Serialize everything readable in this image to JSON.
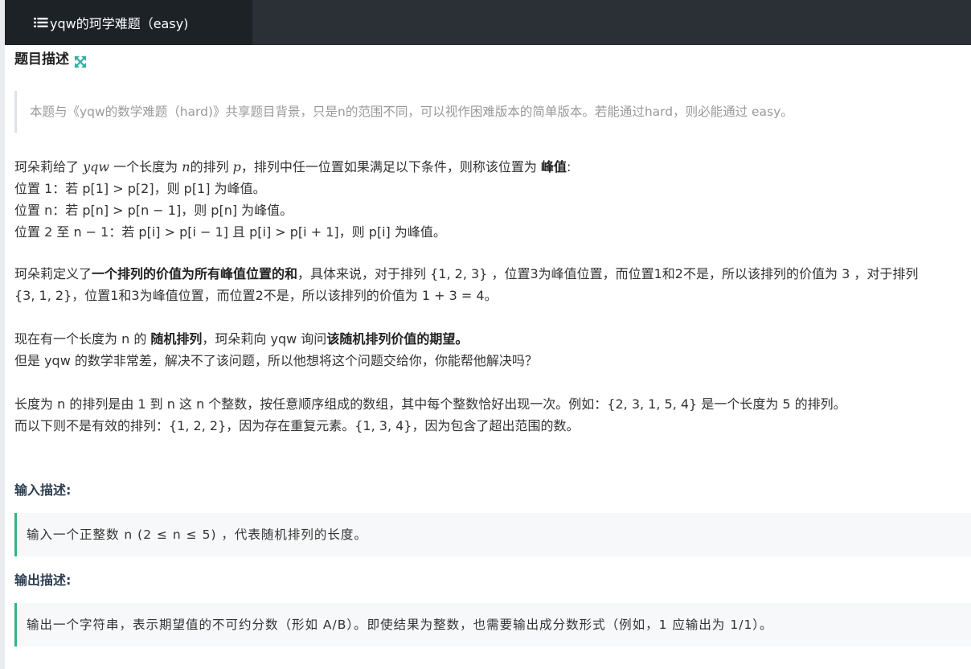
{
  "window": {
    "tab_title": "yqw的珂学难题（easy)",
    "icon": "list-icon"
  },
  "problem": {
    "heading": "题目描述",
    "expand_icon": "expand-arrows-icon",
    "note": "本题与《yqw的数学难题（hard)》共享题目背景，只是n的范围不同，可以视作困难版本的简单版本。若能通过hard，则必能通过 easy。",
    "line1_a": "珂朵莉给了 ",
    "line1_m1": "yqw",
    "line1_b": " 一个长度为 ",
    "line1_m2": "n",
    "line1_c": "的排列 ",
    "line1_m3": "p",
    "line1_d": "，排列中任一位置如果满足以下条件，则称该位置为 ",
    "line1_bold": "峰值",
    "line1_e": ":",
    "line2": "位置 1：若 p[1] > p[2]，则 p[1] 为峰值。",
    "line3": "位置 n：若 p[n] > p[n − 1]，则 p[n] 为峰值。",
    "line4": "位置 2 至 n − 1：若 p[i] > p[i − 1] 且 p[i] > p[i + 1]，则 p[i] 为峰值。",
    "def_a": "珂朵莉定义了",
    "def_bold": "一个排列的价值为所有峰值位置的和",
    "def_b": "，具体来说，对于排列 {1, 2, 3} ，位置3为峰值位置，而位置1和2不是，所以该排列的价值为 3 ，对于排列",
    "def_c": "{3, 1, 2}，位置1和3为峰值位置，而位置2不是，所以该排列的价值为 1 + 3 = 4。",
    "task_a": "现在有一个长度为 n 的 ",
    "task_bold1": "随机排列",
    "task_b": "，珂朵莉向 yqw 询问",
    "task_bold2": "该随机排列价值的期望。",
    "task_line2": "但是 yqw 的数学非常差，解决不了该问题，所以他想将这个问题交给你，你能帮他解决吗？",
    "perm_line1": "长度为 n 的排列是由 1 到 n 这 n 个整数，按任意顺序组成的数组，其中每个整数恰好出现一次。例如：{2, 3, 1, 5, 4} 是一个长度为 5 的排列。",
    "perm_line2": "而以下则不是有效的排列：{1, 2, 2}，因为存在重复元素。{1, 3, 4}，因为包含了超出范围的数。"
  },
  "input": {
    "label": "输入描述:",
    "text": "输入一个正整数 n (2 ≤ n ≤ 5) ，代表随机排列的长度。"
  },
  "output": {
    "label": "输出描述:",
    "text": "输出一个字符串，表示期望值的不可约分数（形如 A/B）。即使结果为整数，也需要输出成分数形式（例如，1  应输出为 1/1）。"
  },
  "colors": {
    "tabbar": "#2a3036",
    "active_tab": "#1d2227",
    "accent_green": "#2eb67d",
    "expand_icon": "#2bb3a0"
  }
}
